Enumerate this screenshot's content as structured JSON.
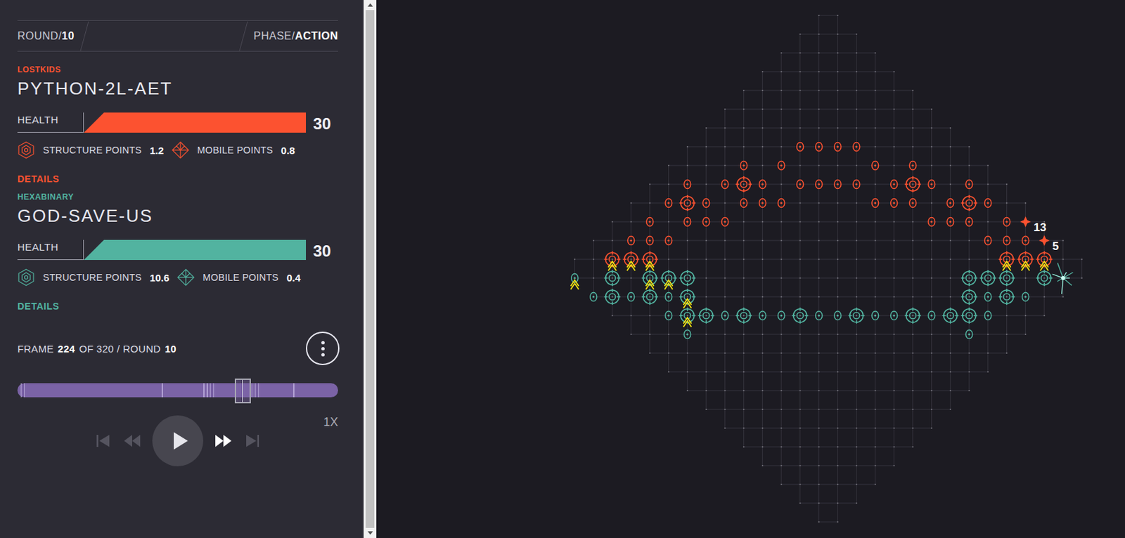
{
  "header": {
    "round": {
      "label": "ROUND/",
      "value": "10"
    },
    "phase": {
      "label": "PHASE/",
      "value": "ACTION"
    }
  },
  "players": [
    {
      "team": "LOSTKIDS",
      "name": "PYTHON-2L-AET",
      "health_label": "HEALTH",
      "health": "30",
      "health_level": 1.0,
      "color": "#fc5230",
      "stats": [
        {
          "label": "STRUCTURE POINTS",
          "value": "1.2",
          "kind": "structure"
        },
        {
          "label": "MOBILE POINTS",
          "value": "0.8",
          "kind": "mobile"
        }
      ],
      "details": "DETAILS"
    },
    {
      "team": "HEXABINARY",
      "name": "GOD-SAVE-US",
      "health_label": "HEALTH",
      "health": "30",
      "health_level": 1.0,
      "color": "#52b3a0",
      "stats": [
        {
          "label": "STRUCTURE POINTS",
          "value": "10.6",
          "kind": "structure"
        },
        {
          "label": "MOBILE POINTS",
          "value": "0.4",
          "kind": "mobile"
        }
      ],
      "details": "DETAILS"
    }
  ],
  "playback": {
    "frame_text": [
      {
        "text": "FRAME",
        "bold": false
      },
      {
        "text": "224",
        "bold": true
      },
      {
        "text": "OF 320 / ROUND",
        "bold": false
      },
      {
        "text": "10",
        "bold": true
      }
    ],
    "level": 0.7,
    "markers": [
      0.01,
      0.02,
      0.45,
      0.58,
      0.59,
      0.6,
      0.61,
      0.73,
      0.74,
      0.75,
      0.86
    ],
    "controls": [
      {
        "kind": "first",
        "disabled": true
      },
      {
        "kind": "back",
        "disabled": true
      },
      {
        "kind": "play",
        "disabled": false
      },
      {
        "kind": "forward",
        "disabled": false
      },
      {
        "kind": "last",
        "disabled": true
      }
    ],
    "speed": "1X"
  },
  "board": {
    "units": [
      {
        "player": 0,
        "kind": "wall",
        "col": 12,
        "row": 20,
        "marked": false
      },
      {
        "player": 0,
        "kind": "wall",
        "col": 13,
        "row": 20,
        "marked": false
      },
      {
        "player": 0,
        "kind": "wall",
        "col": 14,
        "row": 20,
        "marked": false
      },
      {
        "player": 0,
        "kind": "wall",
        "col": 15,
        "row": 20,
        "marked": false
      },
      {
        "player": 0,
        "kind": "wall",
        "col": 9,
        "row": 19,
        "marked": false
      },
      {
        "player": 0,
        "kind": "wall",
        "col": 11,
        "row": 19,
        "marked": false
      },
      {
        "player": 0,
        "kind": "wall",
        "col": 16,
        "row": 19,
        "marked": false
      },
      {
        "player": 0,
        "kind": "wall",
        "col": 18,
        "row": 19,
        "marked": false
      },
      {
        "player": 0,
        "kind": "wall",
        "col": 6,
        "row": 18,
        "marked": false
      },
      {
        "player": 0,
        "kind": "wall",
        "col": 8,
        "row": 18,
        "marked": false
      },
      {
        "player": 0,
        "kind": "turret",
        "col": 9,
        "row": 18,
        "marked": false
      },
      {
        "player": 0,
        "kind": "wall",
        "col": 10,
        "row": 18,
        "marked": false
      },
      {
        "player": 0,
        "kind": "wall",
        "col": 12,
        "row": 18,
        "marked": false
      },
      {
        "player": 0,
        "kind": "wall",
        "col": 13,
        "row": 18,
        "marked": false
      },
      {
        "player": 0,
        "kind": "wall",
        "col": 14,
        "row": 18,
        "marked": false
      },
      {
        "player": 0,
        "kind": "wall",
        "col": 15,
        "row": 18,
        "marked": false
      },
      {
        "player": 0,
        "kind": "wall",
        "col": 17,
        "row": 18,
        "marked": false
      },
      {
        "player": 0,
        "kind": "turret",
        "col": 18,
        "row": 18,
        "marked": false
      },
      {
        "player": 0,
        "kind": "wall",
        "col": 19,
        "row": 18,
        "marked": false
      },
      {
        "player": 0,
        "kind": "wall",
        "col": 21,
        "row": 18,
        "marked": false
      },
      {
        "player": 0,
        "kind": "wall",
        "col": 5,
        "row": 17,
        "marked": false
      },
      {
        "player": 0,
        "kind": "turret",
        "col": 6,
        "row": 17,
        "marked": false
      },
      {
        "player": 0,
        "kind": "wall",
        "col": 7,
        "row": 17,
        "marked": false
      },
      {
        "player": 0,
        "kind": "wall",
        "col": 9,
        "row": 17,
        "marked": false
      },
      {
        "player": 0,
        "kind": "wall",
        "col": 10,
        "row": 17,
        "marked": false
      },
      {
        "player": 0,
        "kind": "wall",
        "col": 11,
        "row": 17,
        "marked": false
      },
      {
        "player": 0,
        "kind": "wall",
        "col": 16,
        "row": 17,
        "marked": false
      },
      {
        "player": 0,
        "kind": "wall",
        "col": 17,
        "row": 17,
        "marked": false
      },
      {
        "player": 0,
        "kind": "wall",
        "col": 18,
        "row": 17,
        "marked": false
      },
      {
        "player": 0,
        "kind": "wall",
        "col": 20,
        "row": 17,
        "marked": false
      },
      {
        "player": 0,
        "kind": "turret",
        "col": 21,
        "row": 17,
        "marked": false
      },
      {
        "player": 0,
        "kind": "wall",
        "col": 22,
        "row": 17,
        "marked": false
      },
      {
        "player": 0,
        "kind": "wall",
        "col": 4,
        "row": 16,
        "marked": false
      },
      {
        "player": 0,
        "kind": "wall",
        "col": 6,
        "row": 16,
        "marked": false
      },
      {
        "player": 0,
        "kind": "wall",
        "col": 7,
        "row": 16,
        "marked": false
      },
      {
        "player": 0,
        "kind": "wall",
        "col": 8,
        "row": 16,
        "marked": false
      },
      {
        "player": 0,
        "kind": "wall",
        "col": 19,
        "row": 16,
        "marked": false
      },
      {
        "player": 0,
        "kind": "wall",
        "col": 20,
        "row": 16,
        "marked": false
      },
      {
        "player": 0,
        "kind": "wall",
        "col": 21,
        "row": 16,
        "marked": false
      },
      {
        "player": 0,
        "kind": "wall",
        "col": 23,
        "row": 16,
        "marked": false
      },
      {
        "player": 0,
        "kind": "wall",
        "col": 3,
        "row": 15,
        "marked": false
      },
      {
        "player": 0,
        "kind": "wall",
        "col": 4,
        "row": 15,
        "marked": false
      },
      {
        "player": 0,
        "kind": "wall",
        "col": 5,
        "row": 15,
        "marked": false
      },
      {
        "player": 0,
        "kind": "wall",
        "col": 22,
        "row": 15,
        "marked": false
      },
      {
        "player": 0,
        "kind": "wall",
        "col": 23,
        "row": 15,
        "marked": false
      },
      {
        "player": 0,
        "kind": "wall",
        "col": 24,
        "row": 15,
        "marked": false
      },
      {
        "player": 0,
        "kind": "turret",
        "col": 2,
        "row": 14,
        "marked": true
      },
      {
        "player": 0,
        "kind": "turret",
        "col": 3,
        "row": 14,
        "marked": true
      },
      {
        "player": 0,
        "kind": "turret",
        "col": 4,
        "row": 14,
        "marked": true
      },
      {
        "player": 0,
        "kind": "turret",
        "col": 23,
        "row": 14,
        "marked": true
      },
      {
        "player": 0,
        "kind": "turret",
        "col": 24,
        "row": 14,
        "marked": true
      },
      {
        "player": 0,
        "kind": "turret",
        "col": 25,
        "row": 14,
        "marked": true
      },
      {
        "player": 1,
        "kind": "wall",
        "col": 0,
        "row": 13,
        "marked": true
      },
      {
        "player": 1,
        "kind": "turret",
        "col": 2,
        "row": 13,
        "marked": false
      },
      {
        "player": 1,
        "kind": "turret",
        "col": 4,
        "row": 13,
        "marked": true
      },
      {
        "player": 1,
        "kind": "turret",
        "col": 5,
        "row": 13,
        "marked": true
      },
      {
        "player": 1,
        "kind": "turret",
        "col": 6,
        "row": 13,
        "marked": false
      },
      {
        "player": 1,
        "kind": "turret",
        "col": 21,
        "row": 13,
        "marked": false
      },
      {
        "player": 1,
        "kind": "turret",
        "col": 22,
        "row": 13,
        "marked": false
      },
      {
        "player": 1,
        "kind": "turret",
        "col": 23,
        "row": 13,
        "marked": false
      },
      {
        "player": 1,
        "kind": "turret",
        "col": 25,
        "row": 13,
        "marked": false
      },
      {
        "player": 1,
        "kind": "wall",
        "col": 1,
        "row": 12,
        "marked": false
      },
      {
        "player": 1,
        "kind": "turret",
        "col": 2,
        "row": 12,
        "marked": false
      },
      {
        "player": 1,
        "kind": "wall",
        "col": 3,
        "row": 12,
        "marked": false
      },
      {
        "player": 1,
        "kind": "turret",
        "col": 4,
        "row": 12,
        "marked": false
      },
      {
        "player": 1,
        "kind": "wall",
        "col": 5,
        "row": 12,
        "marked": false
      },
      {
        "player": 1,
        "kind": "turret",
        "col": 6,
        "row": 12,
        "marked": true
      },
      {
        "player": 1,
        "kind": "turret",
        "col": 21,
        "row": 12,
        "marked": false
      },
      {
        "player": 1,
        "kind": "wall",
        "col": 22,
        "row": 12,
        "marked": false
      },
      {
        "player": 1,
        "kind": "turret",
        "col": 23,
        "row": 12,
        "marked": false
      },
      {
        "player": 1,
        "kind": "wall",
        "col": 24,
        "row": 12,
        "marked": false
      },
      {
        "player": 1,
        "kind": "wall",
        "col": 5,
        "row": 11,
        "marked": false
      },
      {
        "player": 1,
        "kind": "turret",
        "col": 6,
        "row": 11,
        "marked": true
      },
      {
        "player": 1,
        "kind": "turret",
        "col": 7,
        "row": 11,
        "marked": false
      },
      {
        "player": 1,
        "kind": "wall",
        "col": 8,
        "row": 11,
        "marked": false
      },
      {
        "player": 1,
        "kind": "turret",
        "col": 9,
        "row": 11,
        "marked": false
      },
      {
        "player": 1,
        "kind": "wall",
        "col": 10,
        "row": 11,
        "marked": false
      },
      {
        "player": 1,
        "kind": "wall",
        "col": 11,
        "row": 11,
        "marked": false
      },
      {
        "player": 1,
        "kind": "turret",
        "col": 12,
        "row": 11,
        "marked": false
      },
      {
        "player": 1,
        "kind": "wall",
        "col": 13,
        "row": 11,
        "marked": false
      },
      {
        "player": 1,
        "kind": "wall",
        "col": 14,
        "row": 11,
        "marked": false
      },
      {
        "player": 1,
        "kind": "turret",
        "col": 15,
        "row": 11,
        "marked": false
      },
      {
        "player": 1,
        "kind": "wall",
        "col": 16,
        "row": 11,
        "marked": false
      },
      {
        "player": 1,
        "kind": "wall",
        "col": 17,
        "row": 11,
        "marked": false
      },
      {
        "player": 1,
        "kind": "turret",
        "col": 18,
        "row": 11,
        "marked": false
      },
      {
        "player": 1,
        "kind": "wall",
        "col": 19,
        "row": 11,
        "marked": false
      },
      {
        "player": 1,
        "kind": "turret",
        "col": 20,
        "row": 11,
        "marked": false
      },
      {
        "player": 1,
        "kind": "turret",
        "col": 21,
        "row": 11,
        "marked": false
      },
      {
        "player": 1,
        "kind": "wall",
        "col": 22,
        "row": 11,
        "marked": false
      },
      {
        "player": 1,
        "kind": "wall",
        "col": 6,
        "row": 10,
        "marked": false
      },
      {
        "player": 1,
        "kind": "wall",
        "col": 21,
        "row": 10,
        "marked": false
      }
    ],
    "mobiles": [
      {
        "player": 0,
        "col": 24,
        "row": 16,
        "count": "13"
      },
      {
        "player": 0,
        "col": 25,
        "row": 15,
        "count": "5"
      }
    ],
    "hits": [
      {
        "col": 26,
        "row": 13
      }
    ]
  }
}
